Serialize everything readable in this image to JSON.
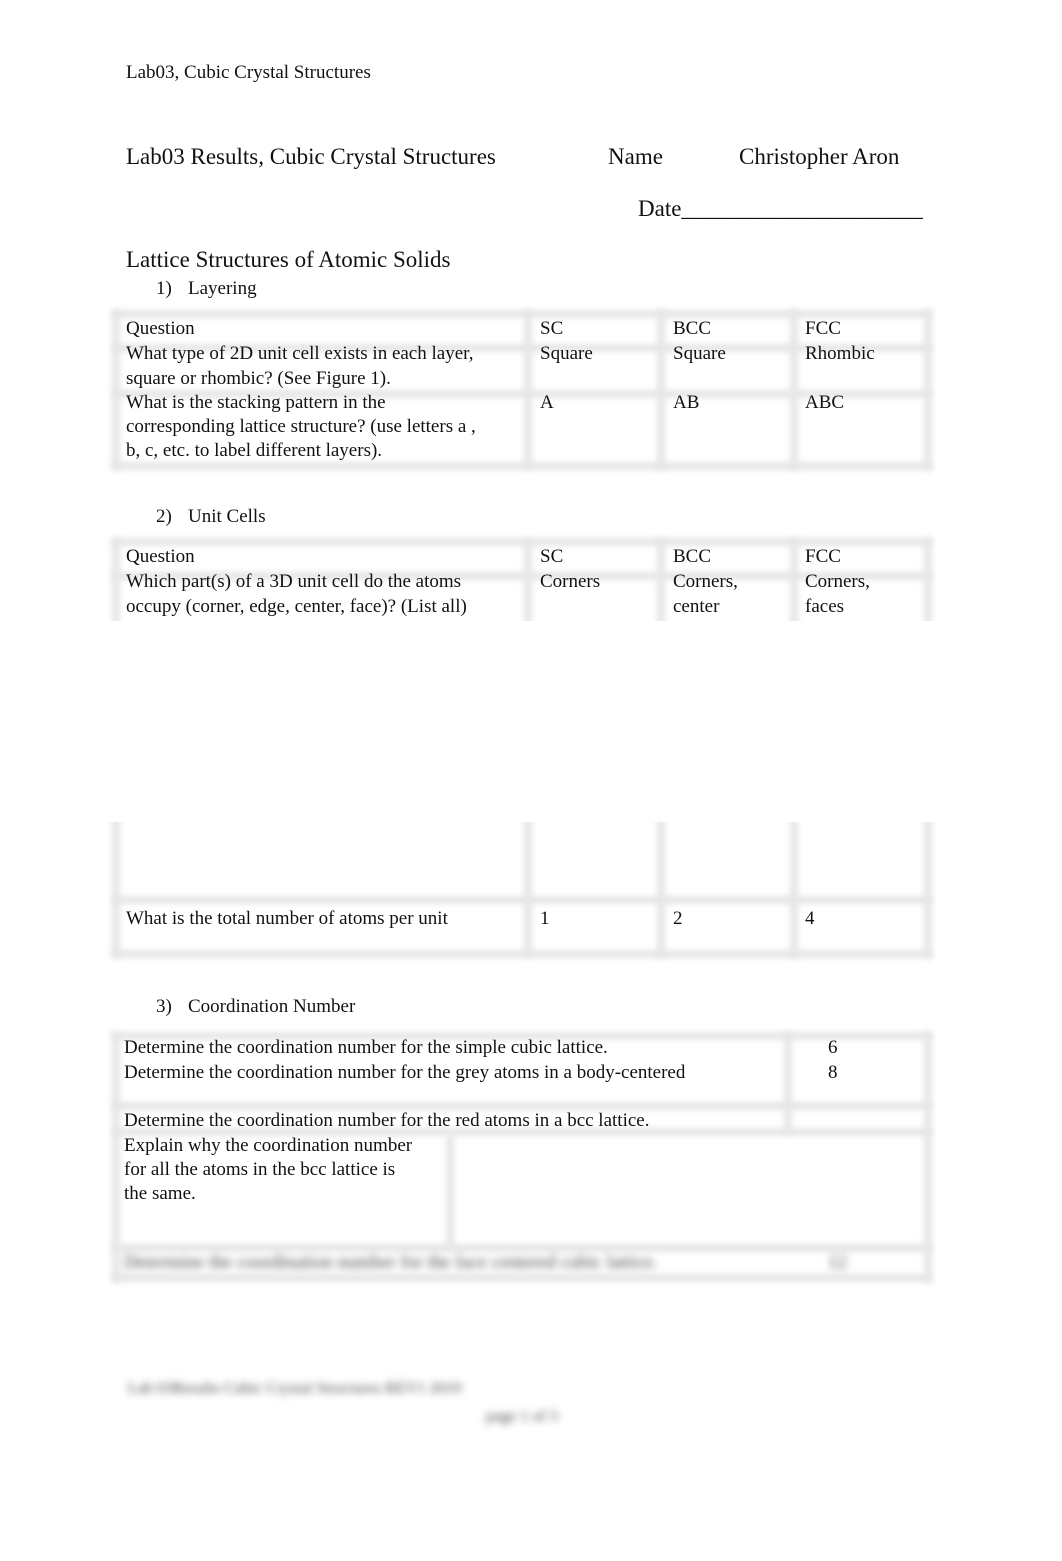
{
  "document": {
    "running_header": "Lab03, Cubic Crystal Structures",
    "title": "Lab03 Results, Cubic Crystal Structures",
    "name_label": "Name",
    "name_value": "Christopher Aron",
    "date_label": "Date",
    "date_blank": "_____________________",
    "section_title": "Lattice Structures of Atomic Solids"
  },
  "layering": {
    "number": "1)",
    "title": "Layering",
    "headers": [
      "Question",
      "SC",
      "BCC",
      "FCC"
    ],
    "rows": [
      {
        "question_lines": [
          "What type of 2D unit cell exists in each layer,",
          "square or rhombic? (See Figure 1)."
        ],
        "sc": "Square",
        "bcc": "Square",
        "fcc": "Rhombic"
      },
      {
        "question_lines": [
          "What is the stacking pattern in the",
          "corresponding lattice structure? (use letters a ,",
          "b, c, etc. to label different layers)."
        ],
        "sc": "A",
        "bcc": "AB",
        "fcc": "ABC"
      }
    ]
  },
  "unit_cells": {
    "number": "2)",
    "title": "Unit Cells",
    "headers": [
      "Question",
      "SC",
      "BCC",
      "FCC"
    ],
    "rows": [
      {
        "question_lines": [
          "Which part(s) of a 3D unit cell do the atoms",
          "occupy (corner, edge, center, face)? (List all)"
        ],
        "sc_lines": [
          "Corners"
        ],
        "bcc_lines": [
          "Corners,",
          "center"
        ],
        "fcc_lines": [
          "Corners,",
          "faces"
        ]
      },
      {
        "question_lines": [
          "What is the total number of atoms per unit"
        ],
        "sc": "1",
        "bcc": "2",
        "fcc": "4"
      }
    ]
  },
  "coordination": {
    "number": "3)",
    "title": "Coordination Number",
    "rows": [
      {
        "question": "Determine the coordination number for the simple cubic lattice.",
        "answer": "6"
      },
      {
        "question": "Determine the coordination number for the grey atoms in a body-centered",
        "answer": "8"
      },
      {
        "question": "Determine the coordination number for the red atoms in a bcc lattice.",
        "answer": ""
      }
    ],
    "explain_lines": [
      "Explain why the coordination number",
      "for all the atoms in the bcc lattice is",
      "the same."
    ],
    "explain_answer": "",
    "obscured_row": "Determine the coordination number for the face centered cubic lattice.",
    "obscured_answer": "12"
  },
  "footer": {
    "obscured_line1": "Lab 03Results Cubic Crystal Structures REV1 2019",
    "obscured_line2": "page 1 of 3"
  }
}
